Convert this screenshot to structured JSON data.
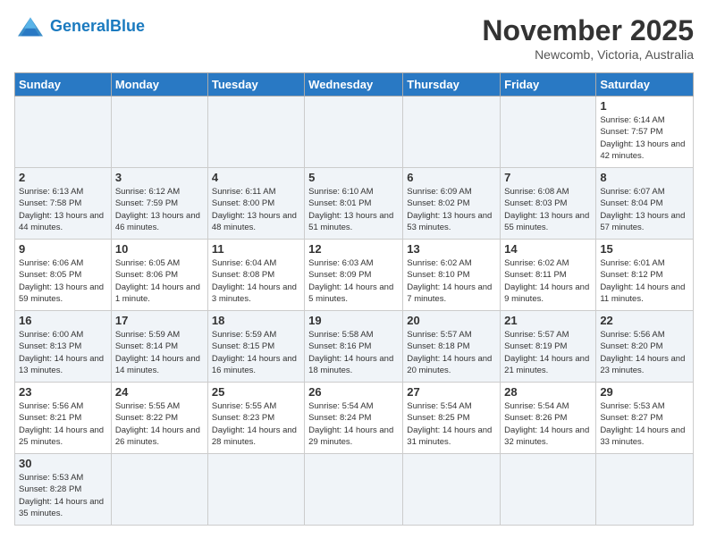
{
  "header": {
    "logo_general": "General",
    "logo_blue": "Blue",
    "month_title": "November 2025",
    "location": "Newcomb, Victoria, Australia"
  },
  "days_of_week": [
    "Sunday",
    "Monday",
    "Tuesday",
    "Wednesday",
    "Thursday",
    "Friday",
    "Saturday"
  ],
  "weeks": [
    [
      {
        "day": "",
        "info": ""
      },
      {
        "day": "",
        "info": ""
      },
      {
        "day": "",
        "info": ""
      },
      {
        "day": "",
        "info": ""
      },
      {
        "day": "",
        "info": ""
      },
      {
        "day": "",
        "info": ""
      },
      {
        "day": "1",
        "info": "Sunrise: 6:14 AM\nSunset: 7:57 PM\nDaylight: 13 hours\nand 42 minutes."
      }
    ],
    [
      {
        "day": "2",
        "info": "Sunrise: 6:13 AM\nSunset: 7:58 PM\nDaylight: 13 hours\nand 44 minutes."
      },
      {
        "day": "3",
        "info": "Sunrise: 6:12 AM\nSunset: 7:59 PM\nDaylight: 13 hours\nand 46 minutes."
      },
      {
        "day": "4",
        "info": "Sunrise: 6:11 AM\nSunset: 8:00 PM\nDaylight: 13 hours\nand 48 minutes."
      },
      {
        "day": "5",
        "info": "Sunrise: 6:10 AM\nSunset: 8:01 PM\nDaylight: 13 hours\nand 51 minutes."
      },
      {
        "day": "6",
        "info": "Sunrise: 6:09 AM\nSunset: 8:02 PM\nDaylight: 13 hours\nand 53 minutes."
      },
      {
        "day": "7",
        "info": "Sunrise: 6:08 AM\nSunset: 8:03 PM\nDaylight: 13 hours\nand 55 minutes."
      },
      {
        "day": "8",
        "info": "Sunrise: 6:07 AM\nSunset: 8:04 PM\nDaylight: 13 hours\nand 57 minutes."
      }
    ],
    [
      {
        "day": "9",
        "info": "Sunrise: 6:06 AM\nSunset: 8:05 PM\nDaylight: 13 hours\nand 59 minutes."
      },
      {
        "day": "10",
        "info": "Sunrise: 6:05 AM\nSunset: 8:06 PM\nDaylight: 14 hours\nand 1 minute."
      },
      {
        "day": "11",
        "info": "Sunrise: 6:04 AM\nSunset: 8:08 PM\nDaylight: 14 hours\nand 3 minutes."
      },
      {
        "day": "12",
        "info": "Sunrise: 6:03 AM\nSunset: 8:09 PM\nDaylight: 14 hours\nand 5 minutes."
      },
      {
        "day": "13",
        "info": "Sunrise: 6:02 AM\nSunset: 8:10 PM\nDaylight: 14 hours\nand 7 minutes."
      },
      {
        "day": "14",
        "info": "Sunrise: 6:02 AM\nSunset: 8:11 PM\nDaylight: 14 hours\nand 9 minutes."
      },
      {
        "day": "15",
        "info": "Sunrise: 6:01 AM\nSunset: 8:12 PM\nDaylight: 14 hours\nand 11 minutes."
      }
    ],
    [
      {
        "day": "16",
        "info": "Sunrise: 6:00 AM\nSunset: 8:13 PM\nDaylight: 14 hours\nand 13 minutes."
      },
      {
        "day": "17",
        "info": "Sunrise: 5:59 AM\nSunset: 8:14 PM\nDaylight: 14 hours\nand 14 minutes."
      },
      {
        "day": "18",
        "info": "Sunrise: 5:59 AM\nSunset: 8:15 PM\nDaylight: 14 hours\nand 16 minutes."
      },
      {
        "day": "19",
        "info": "Sunrise: 5:58 AM\nSunset: 8:16 PM\nDaylight: 14 hours\nand 18 minutes."
      },
      {
        "day": "20",
        "info": "Sunrise: 5:57 AM\nSunset: 8:18 PM\nDaylight: 14 hours\nand 20 minutes."
      },
      {
        "day": "21",
        "info": "Sunrise: 5:57 AM\nSunset: 8:19 PM\nDaylight: 14 hours\nand 21 minutes."
      },
      {
        "day": "22",
        "info": "Sunrise: 5:56 AM\nSunset: 8:20 PM\nDaylight: 14 hours\nand 23 minutes."
      }
    ],
    [
      {
        "day": "23",
        "info": "Sunrise: 5:56 AM\nSunset: 8:21 PM\nDaylight: 14 hours\nand 25 minutes."
      },
      {
        "day": "24",
        "info": "Sunrise: 5:55 AM\nSunset: 8:22 PM\nDaylight: 14 hours\nand 26 minutes."
      },
      {
        "day": "25",
        "info": "Sunrise: 5:55 AM\nSunset: 8:23 PM\nDaylight: 14 hours\nand 28 minutes."
      },
      {
        "day": "26",
        "info": "Sunrise: 5:54 AM\nSunset: 8:24 PM\nDaylight: 14 hours\nand 29 minutes."
      },
      {
        "day": "27",
        "info": "Sunrise: 5:54 AM\nSunset: 8:25 PM\nDaylight: 14 hours\nand 31 minutes."
      },
      {
        "day": "28",
        "info": "Sunrise: 5:54 AM\nSunset: 8:26 PM\nDaylight: 14 hours\nand 32 minutes."
      },
      {
        "day": "29",
        "info": "Sunrise: 5:53 AM\nSunset: 8:27 PM\nDaylight: 14 hours\nand 33 minutes."
      }
    ],
    [
      {
        "day": "30",
        "info": "Sunrise: 5:53 AM\nSunset: 8:28 PM\nDaylight: 14 hours\nand 35 minutes."
      },
      {
        "day": "",
        "info": ""
      },
      {
        "day": "",
        "info": ""
      },
      {
        "day": "",
        "info": ""
      },
      {
        "day": "",
        "info": ""
      },
      {
        "day": "",
        "info": ""
      },
      {
        "day": "",
        "info": ""
      }
    ]
  ]
}
